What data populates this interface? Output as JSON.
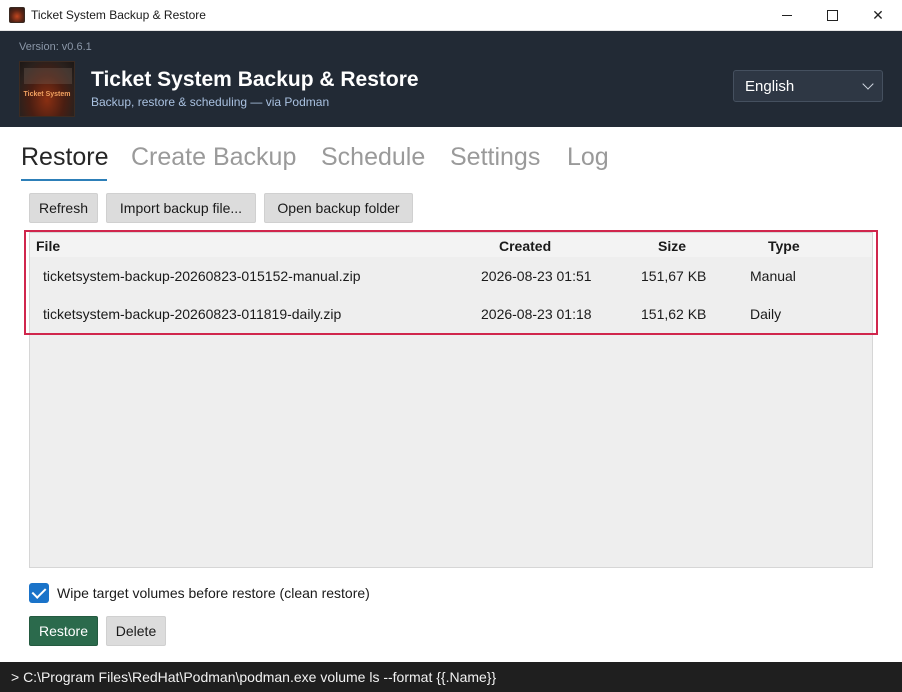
{
  "window": {
    "title": "Ticket System Backup & Restore",
    "controls": {
      "minimize": "",
      "maximize": "",
      "close": "✕"
    }
  },
  "header": {
    "version": "Version: v0.6.1",
    "logo_text": "Ticket System",
    "title": "Ticket System Backup & Restore",
    "subtitle": "Backup, restore & scheduling — via Podman",
    "language": {
      "selected": "English"
    }
  },
  "tabs": [
    {
      "label": "Restore",
      "active": true
    },
    {
      "label": "Create Backup",
      "active": false
    },
    {
      "label": "Schedule",
      "active": false
    },
    {
      "label": "Settings",
      "active": false
    },
    {
      "label": "Log",
      "active": false
    }
  ],
  "toolbar": {
    "refresh": "Refresh",
    "import": "Import backup file...",
    "open_folder": "Open backup folder"
  },
  "table": {
    "columns": {
      "file": "File",
      "created": "Created",
      "size": "Size",
      "type": "Type"
    },
    "rows": [
      {
        "file": "ticketsystem-backup-20260823-015152-manual.zip",
        "created": "2026-08-23 01:51",
        "size": "151,67 KB",
        "type": "Manual"
      },
      {
        "file": "ticketsystem-backup-20260823-011819-daily.zip",
        "created": "2026-08-23 01:18",
        "size": "151,62 KB",
        "type": "Daily"
      }
    ]
  },
  "options": {
    "wipe_label": "Wipe target volumes before restore (clean restore)",
    "wipe_checked": true
  },
  "actions": {
    "restore": "Restore",
    "delete": "Delete"
  },
  "console": {
    "text": "> C:\\Program Files\\RedHat\\Podman\\podman.exe volume ls --format {{.Name}}"
  },
  "colors": {
    "header_bg": "#222a35",
    "accent": "#2d7fb8",
    "restore_button": "#2b6a4c",
    "highlight_border": "#d0264c",
    "checkbox": "#1a73c9"
  }
}
